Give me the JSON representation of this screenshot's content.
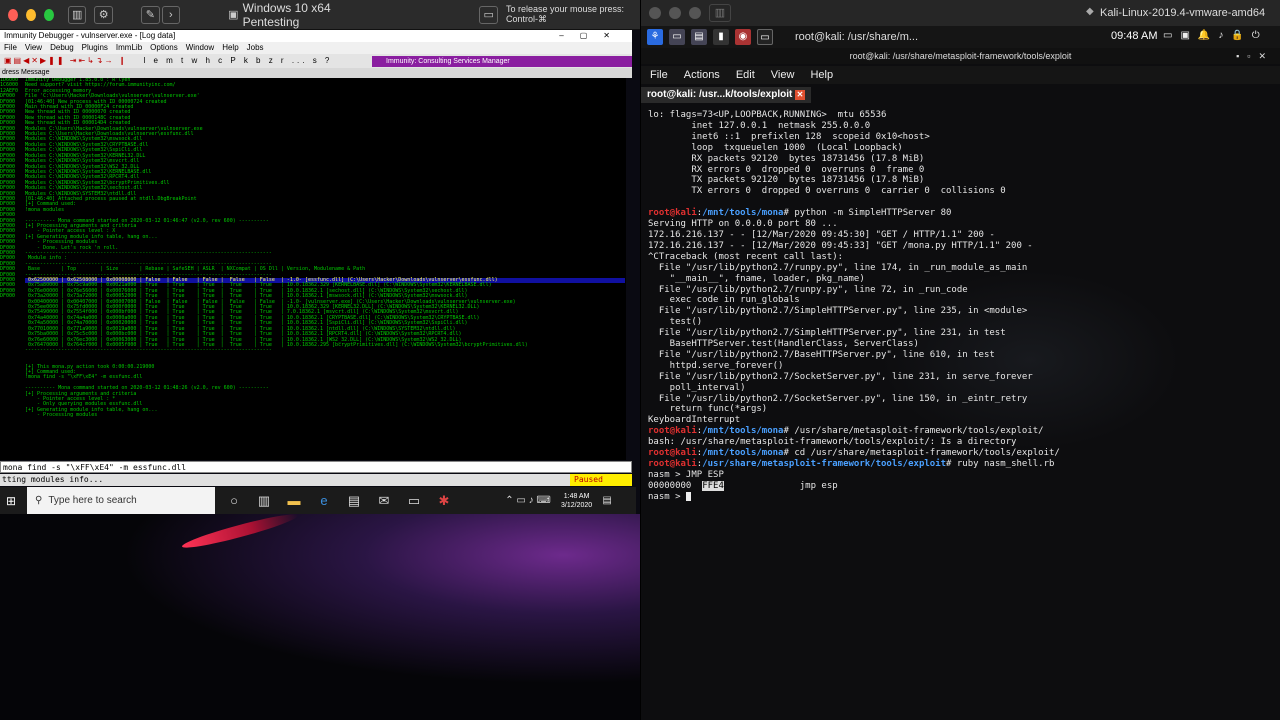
{
  "left_vm": {
    "window_title": "Windows 10 x64 Pentesting",
    "release_hint": "To release your mouse press: Control-⌘",
    "debugger": {
      "title": "Immunity Debugger - vulnserver.exe - [Log data]",
      "menu": [
        "File",
        "View",
        "Debug",
        "Plugins",
        "ImmLib",
        "Options",
        "Window",
        "Help",
        "Jobs"
      ],
      "toolbar_letters": "l e m t w h c P k b z r ... s ?",
      "consulting_label": "Immunity: Consulting Services Manager",
      "columns": "dress  Message",
      "log_lines": [
        "Immunity Debugger 1.85.0.0 : R'lyeh",
        "Need support? visit https://forum.immunityinc.com/",
        "Error accessing memory",
        "File 'C:\\Users\\Hacker\\Downloads\\vulnserver\\vulnserver.exe'",
        "[01:46:40] New process with ID 00000724 created",
        "Main thread with ID 00000F24 created",
        "New thread with ID 00000070 created",
        "New thread with ID 0000148C created",
        "New thread with ID 000014D4 created",
        "Modules C:\\Users\\Hacker\\Downloads\\vulnserver\\vulnserver.exe",
        "Modules C:\\Users\\Hacker\\Downloads\\vulnserver\\essfunc.dll",
        "Modules C:\\WINDOWS\\System32\\mswsock.dll",
        "Modules C:\\WINDOWS\\System32\\CRYPTBASE.dll",
        "Modules C:\\WINDOWS\\System32\\SspiCli.dll",
        "Modules C:\\WINDOWS\\System32\\KERNEL32.DLL",
        "Modules C:\\WINDOWS\\System32\\msvcrt.dll",
        "Modules C:\\WINDOWS\\System32\\WS2_32.DLL",
        "Modules C:\\WINDOWS\\System32\\KERNELBASE.dll",
        "Modules C:\\WINDOWS\\System32\\RPCRT4.dll",
        "Modules C:\\WINDOWS\\System32\\bcryptPrimitives.dll",
        "Modules C:\\WINDOWS\\System32\\sechost.dll",
        "Modules C:\\WINDOWS\\SYSTEM32\\ntdll.dll",
        "[01:46:40] Attached process paused at ntdll.DbgBreakPoint",
        "[+] Command used:",
        "!mona modules",
        "",
        "---------- Mona command started on 2020-03-12 01:46:47 (v2.0, rev 600) ----------",
        "[+] Processing arguments and criteria",
        "    - Pointer access level : X",
        "[+] Generating module info table, hang on...",
        "    - Processing modules",
        "    - Done. Let's rock 'n roll.",
        "----------------------------------------------------------------------------------",
        " Module info :",
        "----------------------------------------------------------------------------------",
        " Base       | Top        | Size       | Rebase | SafeSEH | ASLR  | NXCompat | OS Dll | Version, Modulename & Path",
        "----------------------------------------------------------------------------------",
        " 0x62500000 | 0x62508000 | 0x00008000 | False  | False   | False |  False   | False  | -1.0- [essfunc.dll] (C:\\Users\\Hacker\\Downloads\\vulnserver\\essfunc.dll)",
        " 0x75a80000 | 0x75c9a000 | 0x0021a000 | True   | True    | True  |  True    | True   | 10.0.18362.329 [KERNELBASE.dll] (C:\\WINDOWS\\System32\\KERNELBASE.dll)",
        " 0x76e00000 | 0x76e56000 | 0x00076000 | True   | True    | True  |  True    | True   | 10.0.18362.1 [sechost.dll] (C:\\WINDOWS\\System32\\sechost.dll)",
        " 0x73a20000 | 0x73a72000 | 0x00052000 | True   | True    | True  |  True    | True   | 10.0.18362.1 [mswsock.dll] (C:\\WINDOWS\\System32\\mswsock.dll)",
        " 0x00400000 | 0x00407000 | 0x00007000 | False  | False   | False |  False   | False  | -1.0- [vulnserver.exe] (C:\\Users\\Hacker\\Downloads\\vulnserver\\vulnserver.exe)",
        " 0x75ee0000 | 0x75fd0000 | 0x000f0000 | True   | True    | True  |  True    | True   | 10.0.18362.329 [KERNEL32.DLL] (C:\\WINDOWS\\System32\\KERNEL32.DLL)",
        " 0x75490000 | 0x7554f000 | 0x000bf000 | True   | True    | True  |  True    | True   | 7.0.18362.1 [msvcrt.dll] (C:\\WINDOWS\\System32\\msvcrt.dll)",
        " 0x74a40000 | 0x74a4a000 | 0x0000a000 | True   | True    | True  |  True    | True   | 10.0.18362.1 [CRYPTBASE.dll] (C:\\WINDOWS\\System32\\CRYPTBASE.dll)",
        " 0x74a50000 | 0x74a70000 | 0x00020000 | True   | True    | True  |  True    | True   | 10.0.18362.1 [SspiCli.dll] (C:\\WINDOWS\\System32\\SspiCli.dll)",
        " 0x77010000 | 0x771a9000 | 0x0019a000 | True   | True    | True  |  True    | True   | 10.0.18362.1 [ntdll.dll] (C:\\WINDOWS\\SYSTEM32\\ntdll.dll)",
        " 0x75ba0000 | 0x75c5c000 | 0x000bc000 | True   | True    | True  |  True    | True   | 10.0.18362.1 [RPCRT4.dll] (C:\\WINDOWS\\System32\\RPCRT4.dll)",
        " 0x76e60000 | 0x76ec3000 | 0x00063000 | True   | True    | True  |  True    | True   | 10.0.18362.1 [WS2_32.DLL] (C:\\WINDOWS\\System32\\WS2_32.DLL)",
        " 0x76470000 | 0x764cf000 | 0x0005f000 | True   | True    | True  |  True    | True   | 10.0.18362.295 [bcryptPrimitives.dll] (C:\\WINDOWS\\System32\\bcryptPrimitives.dll)",
        "----------------------------------------------------------------------------------",
        "",
        "",
        "[+] This mona.py action took 0:00:00.219000",
        "[+] Command used:",
        "!mona find -s \"\\xFF\\xE4\" -m essfunc.dll",
        "",
        "---------- Mona command started on 2020-03-12 01:48:26 (v2.0, rev 600) ----------",
        "[+] Processing arguments and criteria",
        "    - Pointer access level : *",
        "    - Only querying modules essfunc.dll",
        "[+] Generating module info table, hang on...",
        "    - Processing modules"
      ],
      "addr_lines": [
        "",
        "",
        "",
        "",
        "",
        "",
        "",
        "",
        "",
        "",
        "1D6000",
        "1C6000",
        "12AEF0",
        "",
        "",
        "",
        "",
        "",
        "",
        "",
        "",
        "",
        "",
        "",
        "",
        "",
        "",
        "",
        "",
        "DF000",
        "DF000",
        "DF000",
        "DF000",
        "DF000",
        "DF000",
        "DF000",
        "DF000",
        "DF000",
        "DF000",
        "DF000",
        "DF000",
        "DF000",
        "DF000",
        "DF000",
        "DF000",
        "DF000",
        "DF000",
        "DF000",
        "DF000",
        "DF000",
        "DF000",
        "DF000",
        "DF000",
        "DF000",
        "DF000",
        "DF000",
        "DF000",
        "DF000",
        "DF000",
        "DF000",
        "DF000",
        "DF000",
        "DF000",
        "DF000",
        "DF000",
        "DF000",
        "DF000"
      ],
      "command_input": "mona find -s \"\\xFF\\xE4\" -m essfunc.dll",
      "status_text": "tting modules info...",
      "paused_label": "Paused"
    },
    "taskbar": {
      "search_placeholder": "Type here to search",
      "time": "1:48 AM",
      "date": "3/12/2020"
    }
  },
  "right_vm": {
    "window_title": "Kali-Linux-2019.4-vmware-amd64",
    "panel_window": "root@kali: /usr/share/m...",
    "time": "09:48 AM",
    "path_title": "root@kali: /usr/share/metasploit-framework/tools/exploit",
    "menu": [
      "File",
      "Actions",
      "Edit",
      "View",
      "Help"
    ],
    "tab_label": "root@kali: /usr...k/tools/exploit",
    "terminal_lines": [
      "lo: flags=73<UP,LOOPBACK,RUNNING>  mtu 65536",
      "        inet 127.0.0.1  netmask 255.0.0.0",
      "        inet6 ::1  prefixlen 128  scopeid 0x10<host>",
      "        loop  txqueuelen 1000  (Local Loopback)",
      "        RX packets 92120  bytes 18731456 (17.8 MiB)",
      "        RX errors 0  dropped 0  overruns 0  frame 0",
      "        TX packets 92120  bytes 18731456 (17.8 MiB)",
      "        TX errors 0  dropped 0 overruns 0  carrier 0  collisions 0",
      ""
    ],
    "prompt_user": "root@kali",
    "cmd1_path": "/mnt/tools/mona",
    "cmd1": "# python -m SimpleHTTPServer 80",
    "output1": [
      "Serving HTTP on 0.0.0.0 port 80 ...",
      "172.16.216.137 - - [12/Mar/2020 09:45:30] \"GET / HTTP/1.1\" 200 -",
      "172.16.216.137 - - [12/Mar/2020 09:45:33] \"GET /mona.py HTTP/1.1\" 200 -",
      "^CTraceback (most recent call last):",
      "  File \"/usr/lib/python2.7/runpy.py\", line 174, in _run_module_as_main",
      "    \"__main__\", fname, loader, pkg_name)",
      "  File \"/usr/lib/python2.7/runpy.py\", line 72, in _run_code",
      "    exec code in run_globals",
      "  File \"/usr/lib/python2.7/SimpleHTTPServer.py\", line 235, in <module>",
      "    test()",
      "  File \"/usr/lib/python2.7/SimpleHTTPServer.py\", line 231, in test",
      "    BaseHTTPServer.test(HandlerClass, ServerClass)",
      "  File \"/usr/lib/python2.7/BaseHTTPServer.py\", line 610, in test",
      "    httpd.serve_forever()",
      "  File \"/usr/lib/python2.7/SocketServer.py\", line 231, in serve_forever",
      "    poll_interval)",
      "  File \"/usr/lib/python2.7/SocketServer.py\", line 150, in _eintr_retry",
      "    return func(*args)",
      "KeyboardInterrupt"
    ],
    "cmd2_path": "/mnt/tools/mona",
    "cmd2": "# /usr/share/metasploit-framework/tools/exploit/",
    "output2": "bash: /usr/share/metasploit-framework/tools/exploit/: Is a directory",
    "cmd3_path": "/mnt/tools/mona",
    "cmd3": "# cd /usr/share/metasploit-framework/tools/exploit/",
    "cmd4_path": "/usr/share/metasploit-framework/tools/exploit",
    "cmd4": "# ruby nasm_shell.rb",
    "nasm1": "nasm > JMP ESP",
    "nasm_addr": "00000000  ",
    "nasm_hex": "FFE4",
    "nasm_asm": "              jmp esp",
    "nasm_prompt": "nasm > "
  }
}
